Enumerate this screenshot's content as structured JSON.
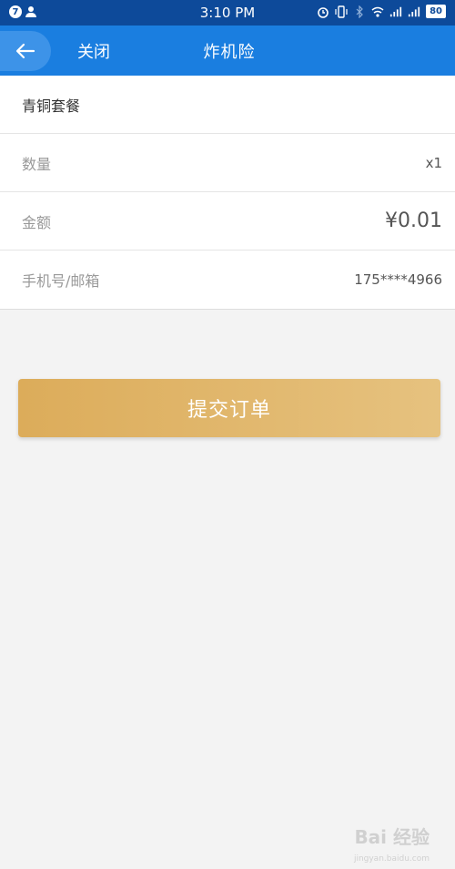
{
  "status_bar": {
    "time": "3:10 PM",
    "notification_count": "7",
    "battery": "80"
  },
  "app_bar": {
    "close_label": "关闭",
    "title": "炸机险"
  },
  "order": {
    "package_name": "青铜套餐",
    "rows": [
      {
        "label": "数量",
        "value": "x1"
      },
      {
        "label": "金额",
        "value": "¥0.01"
      },
      {
        "label": "手机号/邮箱",
        "value": "175****4966"
      }
    ]
  },
  "submit_label": "提交订单",
  "watermark": {
    "text": "Bai 经验",
    "sub": "jingyan.baidu.com"
  },
  "colors": {
    "status_bar": "#0d4a9a",
    "app_bar": "#1a7ee0",
    "button_gold": "#dcac5a",
    "background": "#f3f3f3"
  }
}
